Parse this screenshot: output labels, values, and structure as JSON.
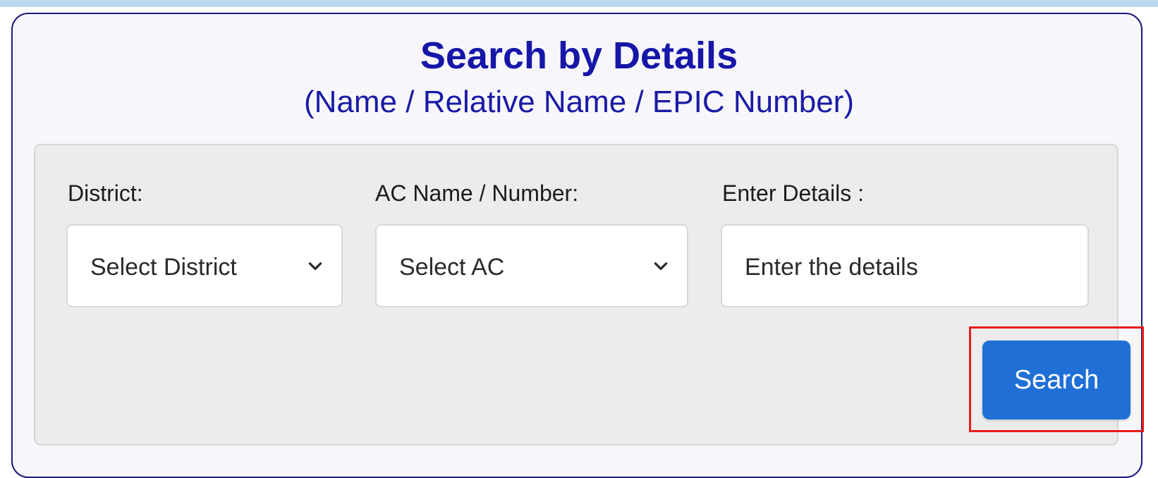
{
  "header": {
    "title": "Search by Details",
    "subtitle": "(Name / Relative Name / EPIC Number)"
  },
  "form": {
    "district": {
      "label": "District:",
      "selected": "Select District"
    },
    "ac": {
      "label": "AC Name / Number:",
      "selected": "Select AC"
    },
    "details": {
      "label": "Enter Details :",
      "placeholder": "Enter the details",
      "value": ""
    },
    "search_label": "Search"
  },
  "colors": {
    "title": "#1616a8",
    "card_border": "#1c1a7a",
    "panel_bg": "#ececec",
    "button_bg": "#1f6fd6",
    "highlight_border": "#e81b1b"
  },
  "icons": {
    "dropdown": "chevron-down-icon"
  }
}
